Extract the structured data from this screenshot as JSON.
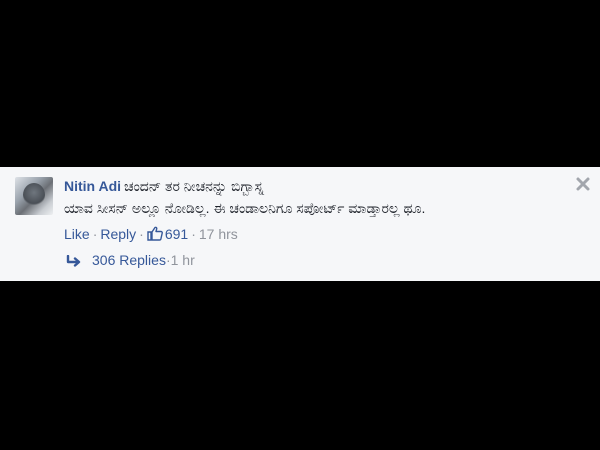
{
  "comment": {
    "author": "Nitin Adi",
    "text_line1": "ಚಂದನ್ ತರ ನೀಚನನ್ನು ಬಿಗ್ಬಾಸ್ನ",
    "text_line2": "ಯಾವ ಸೀಸನ್ ಅಲ್ಲೂ ನೋಡಿಲ್ಲ. ಈ ಚಂಡಾಲನಿಗೂ ಸಪೋರ್ಟ್ ಮಾಡ್ತಾರಲ್ಲ ಥೂ.",
    "actions": {
      "like_label": "Like",
      "reply_label": "Reply",
      "like_count": "691",
      "timestamp": "17 hrs",
      "separator": "·"
    },
    "replies": {
      "label": "306 Replies",
      "timestamp": "1 hr"
    }
  },
  "icons": {
    "close": "close-icon",
    "thumb": "thumbs-up-icon",
    "reply_arrow": "reply-arrow-icon"
  },
  "colors": {
    "link": "#365899",
    "muted": "#90949c",
    "panel": "#f6f7f9"
  }
}
